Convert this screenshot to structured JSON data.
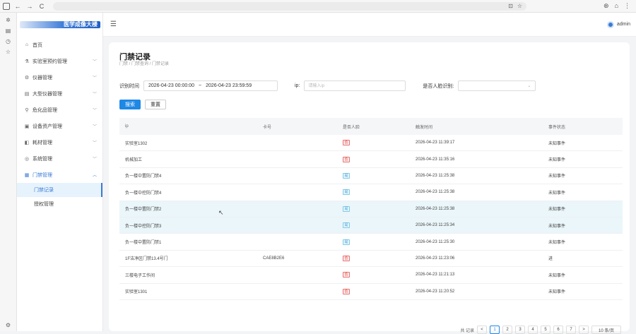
{
  "browser": {
    "nav_back": "←",
    "nav_forward": "→",
    "nav_reload": "C"
  },
  "app": {
    "logo_text": "医学成像大楼",
    "user": "admin"
  },
  "sidebar": {
    "items": [
      {
        "icon": "home-icon",
        "glyph": "⌂",
        "label": "首页",
        "expandable": false
      },
      {
        "icon": "lab-icon",
        "glyph": "⚗",
        "label": "实验室预约管理",
        "expandable": true
      },
      {
        "icon": "instrument-icon",
        "glyph": "⚙",
        "label": "仪器管理",
        "expandable": true
      },
      {
        "icon": "large-instrument-icon",
        "glyph": "▤",
        "label": "大型仪器管理",
        "expandable": true
      },
      {
        "icon": "chemical-icon",
        "glyph": "⚲",
        "label": "危化品管理",
        "expandable": true
      },
      {
        "icon": "asset-icon",
        "glyph": "▣",
        "label": "设备资产管理",
        "expandable": true
      },
      {
        "icon": "supplies-icon",
        "glyph": "◧",
        "label": "耗材管理",
        "expandable": true
      },
      {
        "icon": "system-icon",
        "glyph": "◎",
        "label": "系统管理",
        "expandable": true
      },
      {
        "icon": "access-icon",
        "glyph": "▦",
        "label": "门禁管理",
        "expandable": true,
        "open": true
      }
    ],
    "sub_items": [
      {
        "label": "门禁记录",
        "active": true
      },
      {
        "label": "授权管理",
        "active": false
      }
    ]
  },
  "page": {
    "title": "门禁记录",
    "breadcrumb": "门禁 / 门禁查询 / 门禁记录"
  },
  "filters": {
    "time_label": "识别时间",
    "time_start": "2026-04-23 00:00:00",
    "time_sep": "~",
    "time_end": "2026-04-23 23:59:59",
    "ip_label": "ip:",
    "ip_placeholder": "请输入ip",
    "person_label": "是否人脸识别:",
    "search_button": "搜索",
    "reset_button": "重置"
  },
  "table": {
    "headers": [
      "ip",
      "卡号",
      "是否人脸",
      "触发时间",
      "事件状态"
    ],
    "rows": [
      {
        "ip": "实验室1302",
        "card": "",
        "face": "否",
        "face_type": "red",
        "time": "2026-04-23 11:39:17",
        "status": "未知事件",
        "hl": false
      },
      {
        "ip": "机械加工",
        "card": "",
        "face": "否",
        "face_type": "red",
        "time": "2026-04-23 11:35:16",
        "status": "未知事件",
        "hl": false
      },
      {
        "ip": "负一楼中置防门禁4",
        "card": "",
        "face": "是",
        "face_type": "blue",
        "time": "2026-04-23 11:25:38",
        "status": "未知事件",
        "hl": false
      },
      {
        "ip": "负一楼中控防门禁4",
        "card": "",
        "face": "是",
        "face_type": "blue",
        "time": "2026-04-23 11:25:38",
        "status": "未知事件",
        "hl": false
      },
      {
        "ip": "负一楼中置防门禁2",
        "card": "",
        "face": "是",
        "face_type": "blue",
        "time": "2026-04-23 11:25:38",
        "status": "未知事件",
        "hl": true
      },
      {
        "ip": "负一楼中控防门禁3",
        "card": "",
        "face": "是",
        "face_type": "blue",
        "time": "2026-04-23 11:25:34",
        "status": "未知事件",
        "hl": true
      },
      {
        "ip": "负一楼中置防门禁1",
        "card": "",
        "face": "是",
        "face_type": "blue",
        "time": "2026-04-23 11:25:30",
        "status": "未知事件",
        "hl": false
      },
      {
        "ip": "1F洁净区门禁13.4号门",
        "card": "CAE8B2E6",
        "face": "否",
        "face_type": "red",
        "time": "2026-04-23 11:23:06",
        "status": "进",
        "hl": false
      },
      {
        "ip": "三楼电子工作间",
        "card": "",
        "face": "否",
        "face_type": "red",
        "time": "2026-04-23 11:21:13",
        "status": "未知事件",
        "hl": false
      },
      {
        "ip": "实验室1301",
        "card": "",
        "face": "否",
        "face_type": "red",
        "time": "2026-04-23 11:20:52",
        "status": "未知事件",
        "hl": false
      }
    ]
  },
  "pagination": {
    "total_label": "共 记录",
    "pages": [
      "1",
      "2",
      "3",
      "4",
      "5",
      "6",
      "7"
    ],
    "prev": "<",
    "next": ">",
    "page_size": "10 条/页"
  }
}
